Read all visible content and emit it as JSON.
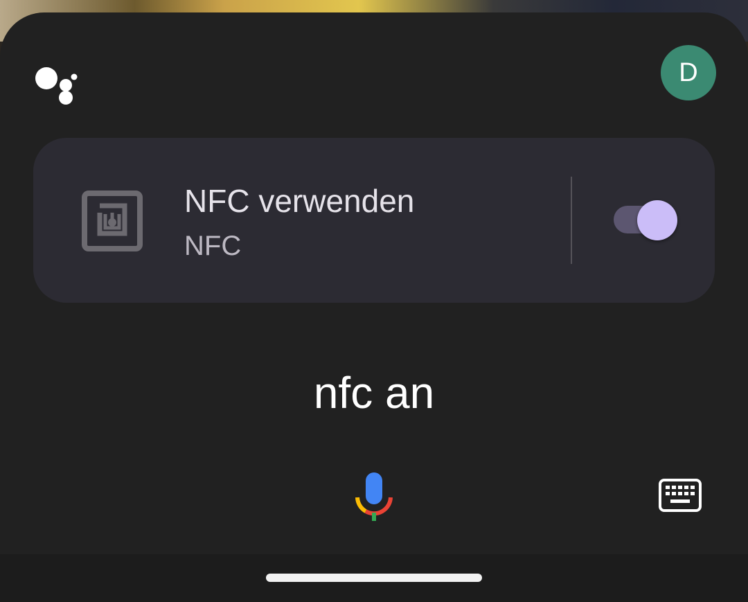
{
  "app": {
    "name": "Google Assistant"
  },
  "header": {
    "logo_icon": "google-assistant-dots-icon",
    "avatar_initial": "D",
    "avatar_color": "#3b8a72"
  },
  "card": {
    "icon": "nfc-icon",
    "title": "NFC verwenden",
    "subtitle": "NFC",
    "toggle_on": true,
    "toggle_color": "#cbbdf8"
  },
  "query": {
    "text": "nfc an"
  },
  "controls": {
    "mic_icon": "google-mic-icon",
    "keyboard_icon": "keyboard-icon"
  },
  "colors": {
    "sheet_background": "#212121",
    "card_background": "#2c2b33",
    "google_blue": "#4285f4",
    "google_red": "#ea4335",
    "google_yellow": "#fbbc04",
    "google_green": "#34a853"
  }
}
